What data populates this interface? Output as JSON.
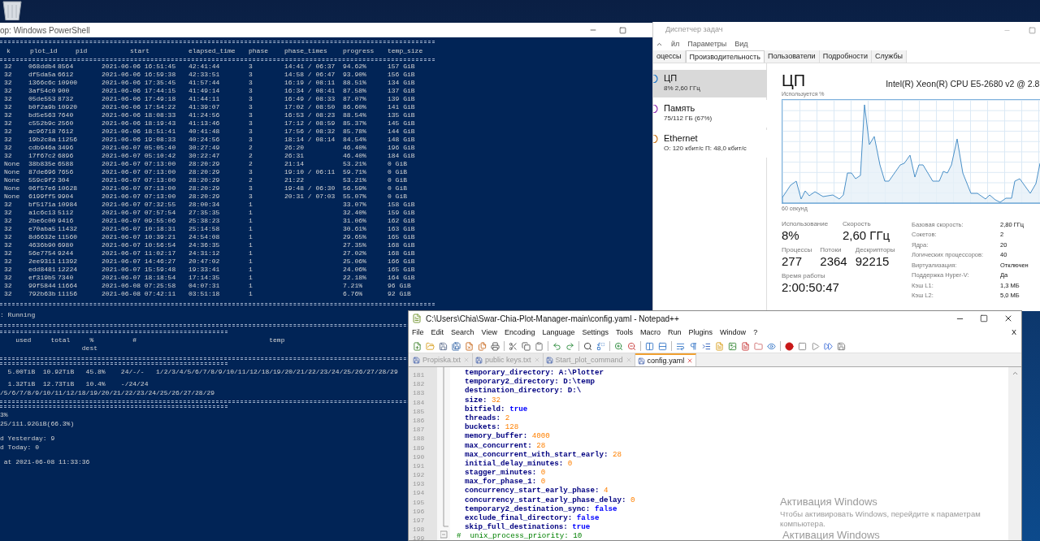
{
  "powershell": {
    "title": "op: Windows PowerShell",
    "table": {
      "columns": [
        "k",
        "plot_id",
        "pid",
        "start",
        "elapsed_time",
        "phase",
        "phase_times",
        "progress",
        "temp_size"
      ],
      "rows": [
        {
          "k": "32",
          "plot_id": "068ddb4",
          "pid": "8564",
          "start": "2021-06-06 16:51:45",
          "elapsed_time": "42:41:44",
          "phase": "3",
          "phase_times": "14:41 / 06:37",
          "progress": "94.62%",
          "temp_size": "157 GiB"
        },
        {
          "k": "32",
          "plot_id": "df5da5a",
          "pid": "6612",
          "start": "2021-06-06 16:59:38",
          "elapsed_time": "42:33:51",
          "phase": "3",
          "phase_times": "14:58 / 06:47",
          "progress": "93.90%",
          "temp_size": "156 GiB"
        },
        {
          "k": "32",
          "plot_id": "1366c6c",
          "pid": "10900",
          "start": "2021-06-06 17:35:45",
          "elapsed_time": "41:57:44",
          "phase": "3",
          "phase_times": "16:19 / 08:11",
          "progress": "88.51%",
          "temp_size": "134 GiB"
        },
        {
          "k": "32",
          "plot_id": "3af54c0",
          "pid": "900",
          "start": "2021-06-06 17:44:15",
          "elapsed_time": "41:49:14",
          "phase": "3",
          "phase_times": "16:34 / 08:41",
          "progress": "87.58%",
          "temp_size": "137 GiB"
        },
        {
          "k": "32",
          "plot_id": "05de553",
          "pid": "8732",
          "start": "2021-06-06 17:49:18",
          "elapsed_time": "41:44:11",
          "phase": "3",
          "phase_times": "16:49 / 08:33",
          "progress": "87.07%",
          "temp_size": "139 GiB"
        },
        {
          "k": "32",
          "plot_id": "b0f2a9b",
          "pid": "10920",
          "start": "2021-06-06 17:54:22",
          "elapsed_time": "41:39:07",
          "phase": "3",
          "phase_times": "17:02 / 08:50",
          "progress": "86.60%",
          "temp_size": "141 GiB"
        },
        {
          "k": "32",
          "plot_id": "bd5e563",
          "pid": "7640",
          "start": "2021-06-06 18:08:33",
          "elapsed_time": "41:24:56",
          "phase": "3",
          "phase_times": "16:53 / 08:23",
          "progress": "88.54%",
          "temp_size": "135 GiB"
        },
        {
          "k": "32",
          "plot_id": "c552b9c",
          "pid": "2560",
          "start": "2021-06-06 18:19:43",
          "elapsed_time": "41:13:46",
          "phase": "3",
          "phase_times": "17:12 / 08:59",
          "progress": "85.37%",
          "temp_size": "145 GiB"
        },
        {
          "k": "32",
          "plot_id": "ac96718",
          "pid": "7612",
          "start": "2021-06-06 18:51:41",
          "elapsed_time": "40:41:48",
          "phase": "3",
          "phase_times": "17:56 / 08:32",
          "progress": "85.78%",
          "temp_size": "144 GiB"
        },
        {
          "k": "32",
          "plot_id": "19b2c8a",
          "pid": "11256",
          "start": "2021-06-06 19:08:33",
          "elapsed_time": "40:24:56",
          "phase": "3",
          "phase_times": "18:14 / 08:14",
          "progress": "84.54%",
          "temp_size": "148 GiB"
        },
        {
          "k": "32",
          "plot_id": "cdb946a",
          "pid": "3496",
          "start": "2021-06-07 05:05:40",
          "elapsed_time": "30:27:49",
          "phase": "2",
          "phase_times": "26:20",
          "progress": "46.40%",
          "temp_size": "196 GiB"
        },
        {
          "k": "32",
          "plot_id": "17f67c2",
          "pid": "6896",
          "start": "2021-06-07 05:10:42",
          "elapsed_time": "30:22:47",
          "phase": "2",
          "phase_times": "26:31",
          "progress": "46.40%",
          "temp_size": "184 GiB"
        },
        {
          "k": "None",
          "plot_id": "38b835e",
          "pid": "6588",
          "start": "2021-06-07 07:13:00",
          "elapsed_time": "28:20:29",
          "phase": "2",
          "phase_times": "21:14",
          "progress": "53.21%",
          "temp_size": "0 GiB"
        },
        {
          "k": "None",
          "plot_id": "87de696",
          "pid": "7656",
          "start": "2021-06-07 07:13:00",
          "elapsed_time": "28:20:29",
          "phase": "3",
          "phase_times": "19:10 / 06:11",
          "progress": "59.71%",
          "temp_size": "0 GiB"
        },
        {
          "k": "None",
          "plot_id": "559c9f2",
          "pid": "304",
          "start": "2021-06-07 07:13:00",
          "elapsed_time": "28:20:29",
          "phase": "2",
          "phase_times": "21:22",
          "progress": "53.21%",
          "temp_size": "0 GiB"
        },
        {
          "k": "None",
          "plot_id": "06f57e6",
          "pid": "10628",
          "start": "2021-06-07 07:13:00",
          "elapsed_time": "28:20:29",
          "phase": "3",
          "phase_times": "19:48 / 06:30",
          "progress": "56.59%",
          "temp_size": "0 GiB"
        },
        {
          "k": "None",
          "plot_id": "6199ff5",
          "pid": "9904",
          "start": "2021-06-07 07:13:00",
          "elapsed_time": "28:20:29",
          "phase": "3",
          "phase_times": "20:31 / 07:03",
          "progress": "55.07%",
          "temp_size": "0 GiB"
        },
        {
          "k": "32",
          "plot_id": "bf5171a",
          "pid": "10984",
          "start": "2021-06-07 07:32:55",
          "elapsed_time": "28:00:34",
          "phase": "1",
          "progress": "33.07%",
          "temp_size": "158 GiB"
        },
        {
          "k": "32",
          "plot_id": "a1c6c13",
          "pid": "5112",
          "start": "2021-06-07 07:57:54",
          "elapsed_time": "27:35:35",
          "phase": "1",
          "progress": "32.40%",
          "temp_size": "159 GiB"
        },
        {
          "k": "32",
          "plot_id": "2be6c00",
          "pid": "9416",
          "start": "2021-06-07 09:55:06",
          "elapsed_time": "25:38:23",
          "phase": "1",
          "progress": "31.06%",
          "temp_size": "162 GiB"
        },
        {
          "k": "32",
          "plot_id": "e70aba5",
          "pid": "11432",
          "start": "2021-06-07 10:18:31",
          "elapsed_time": "25:14:58",
          "phase": "1",
          "progress": "30.61%",
          "temp_size": "163 GiB"
        },
        {
          "k": "32",
          "plot_id": "8d6632e",
          "pid": "11560",
          "start": "2021-06-07 10:39:21",
          "elapsed_time": "24:54:08",
          "phase": "1",
          "progress": "29.65%",
          "temp_size": "165 GiB"
        },
        {
          "k": "32",
          "plot_id": "4636b90",
          "pid": "6980",
          "start": "2021-06-07 10:56:54",
          "elapsed_time": "24:36:35",
          "phase": "1",
          "progress": "27.35%",
          "temp_size": "168 GiB"
        },
        {
          "k": "32",
          "plot_id": "56e7754",
          "pid": "9244",
          "start": "2021-06-07 11:02:17",
          "elapsed_time": "24:31:12",
          "phase": "1",
          "progress": "27.02%",
          "temp_size": "168 GiB"
        },
        {
          "k": "32",
          "plot_id": "2ee9311",
          "pid": "11392",
          "start": "2021-06-07 14:46:27",
          "elapsed_time": "20:47:02",
          "phase": "1",
          "progress": "25.06%",
          "temp_size": "166 GiB"
        },
        {
          "k": "32",
          "plot_id": "edd8481",
          "pid": "12224",
          "start": "2021-06-07 15:59:48",
          "elapsed_time": "19:33:41",
          "phase": "1",
          "progress": "24.06%",
          "temp_size": "165 GiB"
        },
        {
          "k": "32",
          "plot_id": "ef319b5",
          "pid": "7340",
          "start": "2021-06-07 18:18:54",
          "elapsed_time": "17:14:35",
          "phase": "1",
          "progress": "22.18%",
          "temp_size": "164 GiB"
        },
        {
          "k": "32",
          "plot_id": "99f5844",
          "pid": "11664",
          "start": "2021-06-08 07:25:58",
          "elapsed_time": "04:07:31",
          "phase": "1",
          "progress": "7.21%",
          "temp_size": "96 GiB"
        },
        {
          "k": "32",
          "plot_id": "792b63b",
          "pid": "11156",
          "start": "2021-06-08 07:42:11",
          "elapsed_time": "03:51:18",
          "phase": "1",
          "progress": "6.76%",
          "temp_size": "92 GiB"
        }
      ]
    },
    "status_line": ": Running",
    "drive_header_lines": [
      "    used     total     %          #                                  temp",
      "                     dest"
    ],
    "drive_lines": [
      "  5.00TiB  10.92TiB   45.8%    24/-/-   1/2/3/4/5/6/7/8/9/10/11/12/18/19/20/21/22/23/24/25/26/27/28/29",
      "  1.32TiB  12.73TiB   10.4%    -/24/24",
      "/5/6/7/8/9/10/11/12/18/19/20/21/22/23/24/25/26/27/28/29"
    ],
    "summary_lines": [
      "3%",
      "25/111.92GiB(66.3%)"
    ],
    "count_lines": [
      "d Yesterday: 9",
      "d Today: 0"
    ],
    "timestamp_line": " at 2021-06-08 11:33:36"
  },
  "task_manager": {
    "title": "Диспетчер задач",
    "menu": [
      "йл",
      "Параметры",
      "Вид"
    ],
    "tabs": [
      {
        "label": "оцессы",
        "selected": false
      },
      {
        "label": "Производительность",
        "selected": true
      },
      {
        "label": "Пользователи",
        "selected": false
      },
      {
        "label": "Подробности",
        "selected": false
      },
      {
        "label": "Службы",
        "selected": false
      }
    ],
    "resources": [
      {
        "name": "ЦП",
        "detail": "8% 2,60 ГГц",
        "selected": true,
        "color": "#1a73c8"
      },
      {
        "name": "Память",
        "detail": "75/112 ГБ (67%)",
        "selected": false,
        "color": "#8b2fb0"
      },
      {
        "name": "Ethernet",
        "detail": "О: 120 кбит/с П: 48,0 кбит/с",
        "selected": false,
        "color": "#c8741a"
      }
    ],
    "heading": "ЦП",
    "cpu_model": "Intel(R) Xeon(R) CPU E5-2680 v2 @ 2.8",
    "graph_label": "Используется %",
    "graph_span": "60 секунд",
    "stats": [
      [
        {
          "label": "Использование",
          "value": "8%"
        },
        {
          "label": "Скорость",
          "value": "2,60 ГГц"
        }
      ],
      [
        {
          "label": "Процессы",
          "value": "277"
        },
        {
          "label": "Потоки",
          "value": "2364"
        },
        {
          "label": "Дескрипторы",
          "value": "92215"
        }
      ],
      [
        {
          "label": "Время работы",
          "value": "2:00:50:47"
        }
      ]
    ],
    "specs": [
      {
        "label": "Базовая скорость:",
        "value": "2,80 ГГц"
      },
      {
        "label": "Сокетов:",
        "value": "2"
      },
      {
        "label": "Ядра:",
        "value": "20"
      },
      {
        "label": "Логических процессоров:",
        "value": "40"
      },
      {
        "label": "Виртуализация:",
        "value": "Отключен"
      },
      {
        "label": "Поддержка Hyper-V:",
        "value": "Да"
      },
      {
        "label": "Кэш L1:",
        "value": "1,3 МБ"
      },
      {
        "label": "Кэш L2:",
        "value": "5,0 МБ"
      }
    ]
  },
  "notepad": {
    "title": "C:\\Users\\Chia\\Swar-Chia-Plot-Manager-main\\config.yaml - Notepad++",
    "menu": [
      "File",
      "Edit",
      "Search",
      "View",
      "Encoding",
      "Language",
      "Settings",
      "Tools",
      "Macro",
      "Run",
      "Plugins",
      "Window",
      "?"
    ],
    "menu_close": "X",
    "tabs": [
      {
        "label": "Propiska.txt",
        "selected": false
      },
      {
        "label": "public keys.txt",
        "selected": false
      },
      {
        "label": "Start_plot_command",
        "selected": false
      },
      {
        "label": "config.yaml",
        "selected": true
      }
    ],
    "lines": [
      {
        "number": "181",
        "kind": "string",
        "key": "temporary_directory:",
        "value": "A:\\Plotter"
      },
      {
        "number": "182",
        "kind": "string",
        "key": "temporary2_directory:",
        "value": "D:\\temp"
      },
      {
        "number": "183",
        "kind": "string",
        "key": "destination_directory:",
        "value": "D:\\"
      },
      {
        "number": "184",
        "kind": "number",
        "key": "size:",
        "value": "32"
      },
      {
        "number": "185",
        "kind": "bool",
        "key": "bitfield:",
        "value": "true"
      },
      {
        "number": "186",
        "kind": "number",
        "key": "threads:",
        "value": "2"
      },
      {
        "number": "187",
        "kind": "number",
        "key": "buckets:",
        "value": "128"
      },
      {
        "number": "188",
        "kind": "number",
        "key": "memory_buffer:",
        "value": "4000"
      },
      {
        "number": "189",
        "kind": "number",
        "key": "max_concurrent:",
        "value": "28"
      },
      {
        "number": "190",
        "kind": "number",
        "key": "max_concurrent_with_start_early:",
        "value": "28"
      },
      {
        "number": "191",
        "kind": "number",
        "key": "initial_delay_minutes:",
        "value": "0"
      },
      {
        "number": "192",
        "kind": "number",
        "key": "stagger_minutes:",
        "value": "0"
      },
      {
        "number": "193",
        "kind": "number",
        "key": "max_for_phase_1:",
        "value": "0"
      },
      {
        "number": "194",
        "kind": "number",
        "key": "concurrency_start_early_phase:",
        "value": "4"
      },
      {
        "number": "195",
        "kind": "number",
        "key": "concurrency_start_early_phase_delay:",
        "value": "0"
      },
      {
        "number": "196",
        "kind": "bool",
        "key": "temporary2_destination_sync:",
        "value": "false"
      },
      {
        "number": "197",
        "kind": "bool",
        "key": "exclude_final_directory:",
        "value": "false"
      },
      {
        "number": "198",
        "kind": "bool",
        "key": "skip_full_destinations:",
        "value": "true"
      },
      {
        "number": "199",
        "kind": "comment",
        "text": "#  unix_process_priority: 10"
      }
    ]
  },
  "activation": {
    "title": "Активация Windows",
    "message": "Чтобы активировать Windows, перейдите к параметрам",
    "message_end": "компьютера.",
    "title_repeat": "Активация Windows"
  }
}
